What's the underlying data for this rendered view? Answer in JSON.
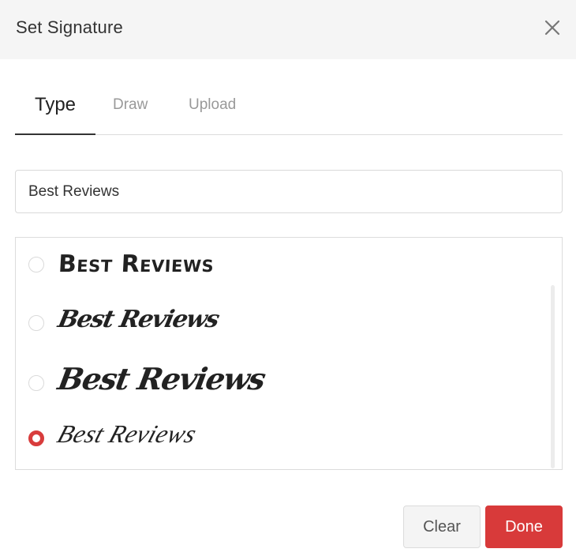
{
  "dialog": {
    "title": "Set Signature",
    "close_icon": "close-icon"
  },
  "tabs": [
    {
      "label": "Type",
      "active": true
    },
    {
      "label": "Draw",
      "active": false
    },
    {
      "label": "Upload",
      "active": false
    }
  ],
  "name_input": {
    "value": "Best Reviews"
  },
  "signature_options": [
    {
      "text": "Best Reviews",
      "selected": false
    },
    {
      "text": "Best Reviews",
      "selected": false
    },
    {
      "text": "Best Reviews",
      "selected": false
    },
    {
      "text": "Best Reviews",
      "selected": true
    }
  ],
  "buttons": {
    "clear_label": "Clear",
    "done_label": "Done"
  },
  "colors": {
    "accent": "#d83a3a",
    "header_bg": "#f5f5f5"
  }
}
